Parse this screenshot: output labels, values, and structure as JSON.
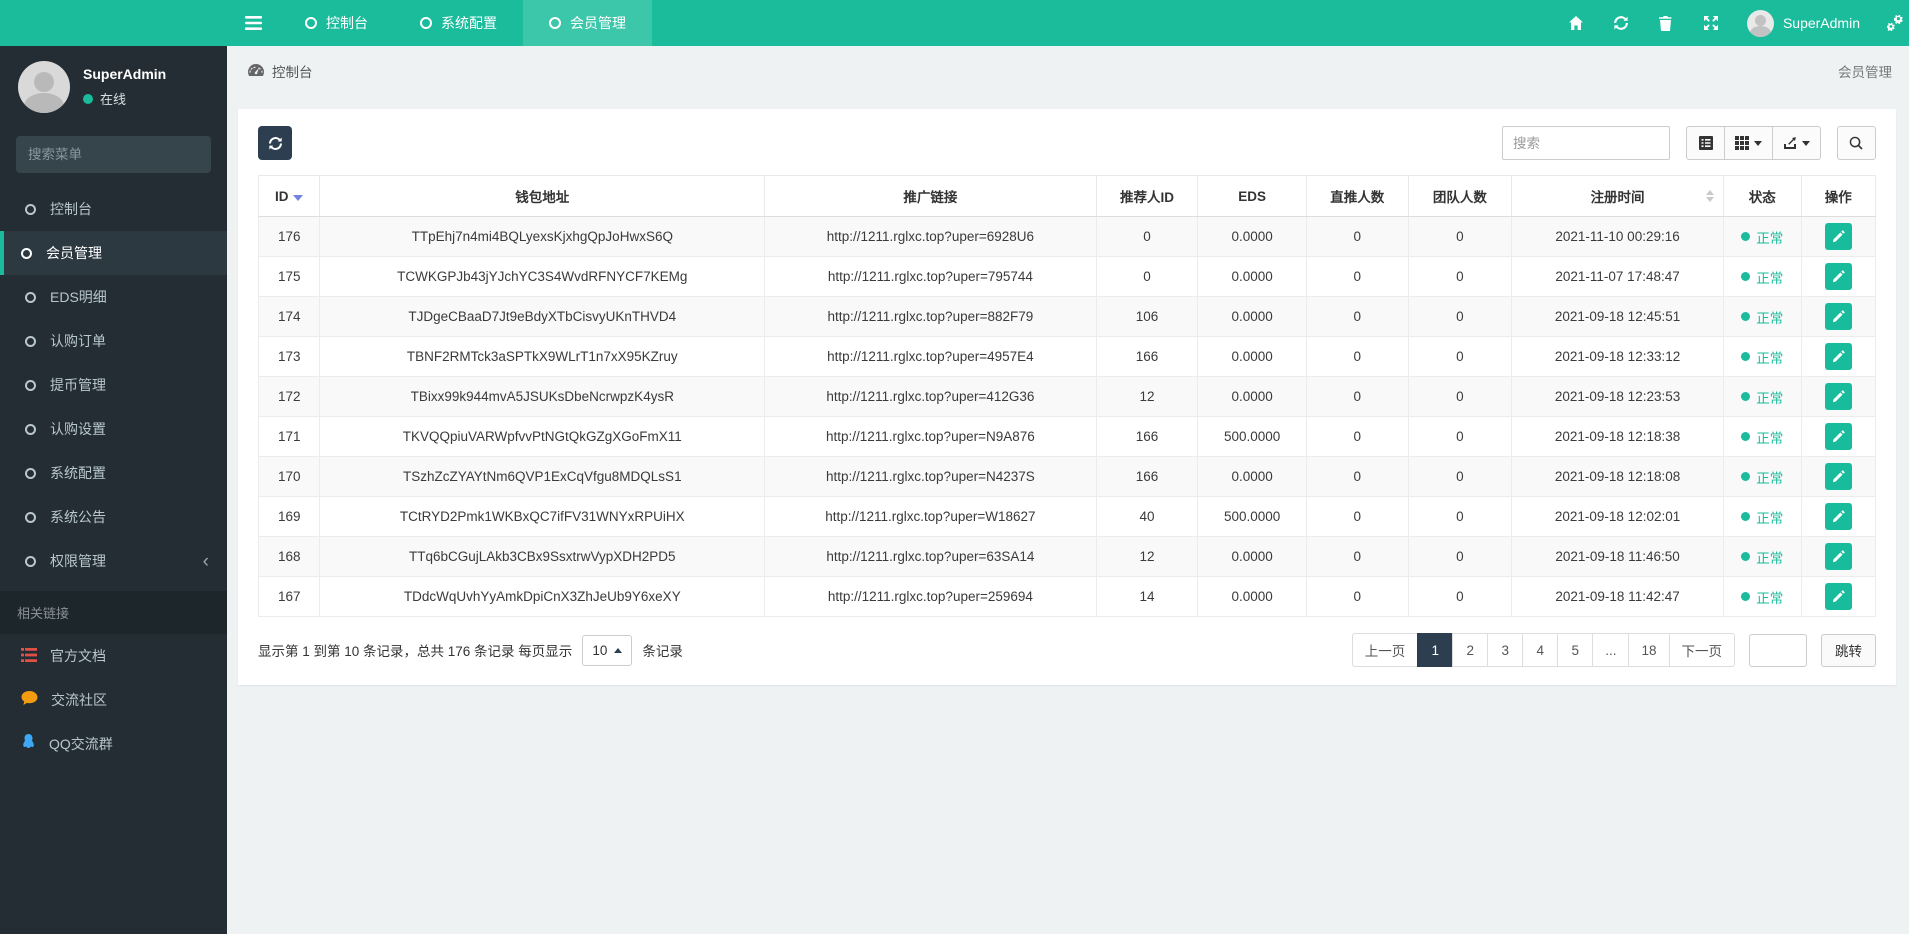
{
  "topbar": {
    "tabs": [
      {
        "label": "控制台",
        "active": false
      },
      {
        "label": "系统配置",
        "active": false
      },
      {
        "label": "会员管理",
        "active": true
      }
    ],
    "right_icons": [
      "home-icon",
      "refresh-icon",
      "trash-icon",
      "fullscreen-icon",
      "gears-icon"
    ],
    "user": {
      "name": "SuperAdmin"
    }
  },
  "sidebar": {
    "user": {
      "name": "SuperAdmin",
      "status": "在线"
    },
    "search_placeholder": "搜索菜单",
    "menu": [
      {
        "label": "控制台",
        "active": false
      },
      {
        "label": "会员管理",
        "active": true
      },
      {
        "label": "EDS明细",
        "active": false
      },
      {
        "label": "认购订单",
        "active": false
      },
      {
        "label": "提币管理",
        "active": false
      },
      {
        "label": "认购设置",
        "active": false
      },
      {
        "label": "系统配置",
        "active": false
      },
      {
        "label": "系统公告",
        "active": false
      },
      {
        "label": "权限管理",
        "active": false,
        "chevron": true
      }
    ],
    "section_label": "相关链接",
    "links": [
      {
        "label": "官方文档",
        "icon": "docs-icon",
        "color": "#e05045"
      },
      {
        "label": "交流社区",
        "icon": "chat-icon",
        "color": "#f39c12"
      },
      {
        "label": "QQ交流群",
        "icon": "qq-icon",
        "color": "#3da8f5"
      }
    ]
  },
  "breadcrumb": {
    "left": "控制台",
    "right": "会员管理"
  },
  "toolbar": {
    "search_placeholder": "搜索"
  },
  "table": {
    "columns": [
      {
        "label": "ID",
        "sort": "desc"
      },
      {
        "label": "钱包地址"
      },
      {
        "label": "推广链接"
      },
      {
        "label": "推荐人ID"
      },
      {
        "label": "EDS"
      },
      {
        "label": "直推人数"
      },
      {
        "label": "团队人数"
      },
      {
        "label": "注册时间",
        "sort": "both"
      },
      {
        "label": "状态"
      },
      {
        "label": "操作"
      }
    ],
    "rows": [
      {
        "id": "176",
        "wallet": "TTpEhj7n4mi4BQLyexsKjxhgQpJoHwxS6Q",
        "link": "http://1211.rglxc.top?uper=6928U6",
        "ref_id": "0",
        "eds": "0.0000",
        "direct": "0",
        "team": "0",
        "reg_time": "2021-11-10 00:29:16",
        "status": "正常"
      },
      {
        "id": "175",
        "wallet": "TCWKGPJb43jYJchYC3S4WvdRFNYCF7KEMg",
        "link": "http://1211.rglxc.top?uper=795744",
        "ref_id": "0",
        "eds": "0.0000",
        "direct": "0",
        "team": "0",
        "reg_time": "2021-11-07 17:48:47",
        "status": "正常"
      },
      {
        "id": "174",
        "wallet": "TJDgeCBaaD7Jt9eBdyXTbCisvyUKnTHVD4",
        "link": "http://1211.rglxc.top?uper=882F79",
        "ref_id": "106",
        "eds": "0.0000",
        "direct": "0",
        "team": "0",
        "reg_time": "2021-09-18 12:45:51",
        "status": "正常"
      },
      {
        "id": "173",
        "wallet": "TBNF2RMTck3aSPTkX9WLrT1n7xX95KZruy",
        "link": "http://1211.rglxc.top?uper=4957E4",
        "ref_id": "166",
        "eds": "0.0000",
        "direct": "0",
        "team": "0",
        "reg_time": "2021-09-18 12:33:12",
        "status": "正常"
      },
      {
        "id": "172",
        "wallet": "TBixx99k944mvA5JSUKsDbeNcrwpzK4ysR",
        "link": "http://1211.rglxc.top?uper=412G36",
        "ref_id": "12",
        "eds": "0.0000",
        "direct": "0",
        "team": "0",
        "reg_time": "2021-09-18 12:23:53",
        "status": "正常"
      },
      {
        "id": "171",
        "wallet": "TKVQQpiuVARWpfvvPtNGtQkGZgXGoFmX11",
        "link": "http://1211.rglxc.top?uper=N9A876",
        "ref_id": "166",
        "eds": "500.0000",
        "direct": "0",
        "team": "0",
        "reg_time": "2021-09-18 12:18:38",
        "status": "正常"
      },
      {
        "id": "170",
        "wallet": "TSzhZcZYAYtNm6QVP1ExCqVfgu8MDQLsS1",
        "link": "http://1211.rglxc.top?uper=N4237S",
        "ref_id": "166",
        "eds": "0.0000",
        "direct": "0",
        "team": "0",
        "reg_time": "2021-09-18 12:18:08",
        "status": "正常"
      },
      {
        "id": "169",
        "wallet": "TCtRYD2Pmk1WKBxQC7ifFV31WNYxRPUiHX",
        "link": "http://1211.rglxc.top?uper=W18627",
        "ref_id": "40",
        "eds": "500.0000",
        "direct": "0",
        "team": "0",
        "reg_time": "2021-09-18 12:02:01",
        "status": "正常"
      },
      {
        "id": "168",
        "wallet": "TTq6bCGujLAkb3CBx9SsxtrwVypXDH2PD5",
        "link": "http://1211.rglxc.top?uper=63SA14",
        "ref_id": "12",
        "eds": "0.0000",
        "direct": "0",
        "team": "0",
        "reg_time": "2021-09-18 11:46:50",
        "status": "正常"
      },
      {
        "id": "167",
        "wallet": "TDdcWqUvhYyAmkDpiCnX3ZhJeUb9Y6xeXY",
        "link": "http://1211.rglxc.top?uper=259694",
        "ref_id": "14",
        "eds": "0.0000",
        "direct": "0",
        "team": "0",
        "reg_time": "2021-09-18 11:42:47",
        "status": "正常"
      }
    ]
  },
  "pagination": {
    "info_prefix": "显示第 1 到第 10 条记录，总共 176 条记录 每页显示",
    "page_size": "10",
    "info_suffix": "条记录",
    "prev": "上一页",
    "next": "下一页",
    "pages": [
      {
        "label": "1",
        "active": true
      },
      {
        "label": "2"
      },
      {
        "label": "3"
      },
      {
        "label": "4"
      },
      {
        "label": "5"
      },
      {
        "label": "..."
      },
      {
        "label": "18"
      }
    ],
    "jump": "跳转"
  },
  "colors": {
    "accent_teal": "#1abc9c",
    "dark_navy": "#2c3e50",
    "status_ok": "#18bc9c",
    "sidebar_bg": "#232d33"
  }
}
